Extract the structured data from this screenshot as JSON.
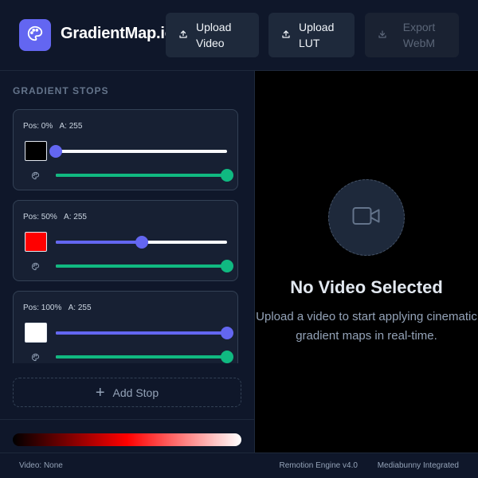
{
  "header": {
    "title": "GradientMap.io",
    "logo_icon": "palette-icon",
    "upload_video_label": "Upload Video",
    "upload_lut_label": "Upload LUT",
    "export_label": "Export WebM",
    "accent_color": "#6366f1"
  },
  "sidebar": {
    "section_title": "GRADIENT STOPS",
    "stops": [
      {
        "pos_label": "Pos: 0%",
        "alpha_label": "A: 255",
        "color": "#000000",
        "position": 0,
        "alpha": 255
      },
      {
        "pos_label": "Pos: 50%",
        "alpha_label": "A: 255",
        "color": "#ff0000",
        "position": 50,
        "alpha": 255
      },
      {
        "pos_label": "Pos: 100%",
        "alpha_label": "A: 255",
        "color": "#ffffff",
        "position": 100,
        "alpha": 255
      }
    ],
    "add_stop_label": "Add Stop"
  },
  "main": {
    "empty_icon": "video-camera-icon",
    "empty_title": "No Video Selected",
    "empty_description": "Upload a video to start applying cinematic gradient maps in real-time."
  },
  "footer": {
    "video_status": "Video: None",
    "engine": "Remotion Engine v4.0",
    "integration": "Mediabunny Integrated"
  }
}
